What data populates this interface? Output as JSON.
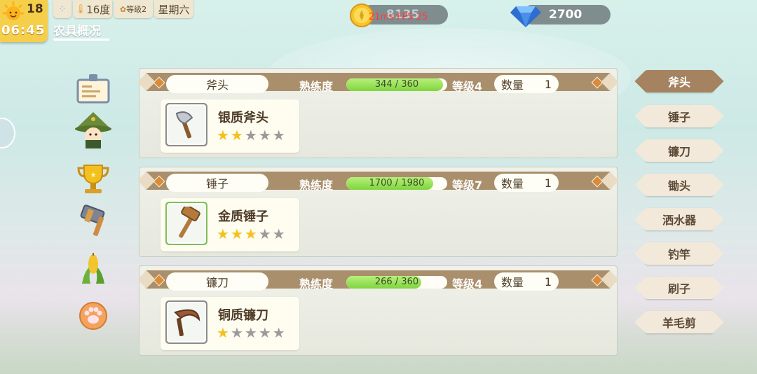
{
  "hud": {
    "day": "18",
    "time": "06:45",
    "temperature": "16度",
    "level": "等级2",
    "weekday": "星期六",
    "tab": "农具概况"
  },
  "currency": {
    "gold": "8135",
    "diamond": "2700",
    "debug": "21ms   FPS 25"
  },
  "tools": [
    {
      "category": "斧头",
      "prof_label": "熟练度",
      "prof": "344 / 360",
      "prof_ratio": 0.955,
      "level": "等级4",
      "qty_label": "数量",
      "qty": "1",
      "name": "银质斧头",
      "stars": 2,
      "max_stars": 5
    },
    {
      "category": "锤子",
      "prof_label": "熟练度",
      "prof": "1700 / 1980",
      "prof_ratio": 0.86,
      "level": "等级7",
      "qty_label": "数量",
      "qty": "1",
      "name": "金质锤子",
      "stars": 3,
      "max_stars": 5
    },
    {
      "category": "镰刀",
      "prof_label": "熟练度",
      "prof": "266 / 360",
      "prof_ratio": 0.74,
      "level": "等级4",
      "qty_label": "数量",
      "qty": "1",
      "name": "铜质镰刀",
      "stars": 1,
      "max_stars": 5
    }
  ],
  "categories": [
    "斧头",
    "锤子",
    "镰刀",
    "锄头",
    "洒水器",
    "钓竿",
    "刷子",
    "羊毛剪"
  ],
  "active_category": "斧头",
  "side_icons": [
    "id-card-icon",
    "character-icon",
    "trophy-icon",
    "hammer-icon",
    "corn-icon",
    "paw-icon"
  ],
  "colors": {
    "progress": "#7fd53e",
    "banner": "#a98f6c",
    "active_tab": "#a58260",
    "star": "#f4c11c"
  }
}
